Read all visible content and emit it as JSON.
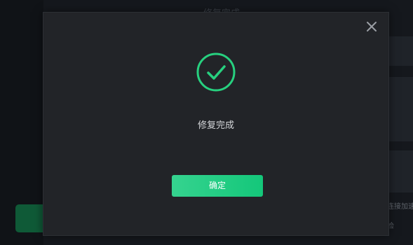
{
  "dialog": {
    "message": "修复完成",
    "confirm_label": "确定",
    "close_icon": "close-icon",
    "status_icon": "check-circle-icon"
  },
  "background": {
    "title_fragment": "修复完成",
    "side_text": "连接加速",
    "side_text_2": "检"
  },
  "colors": {
    "accent": "#27d07f",
    "dialog_bg": "#222428",
    "page_bg": "#15181d"
  }
}
